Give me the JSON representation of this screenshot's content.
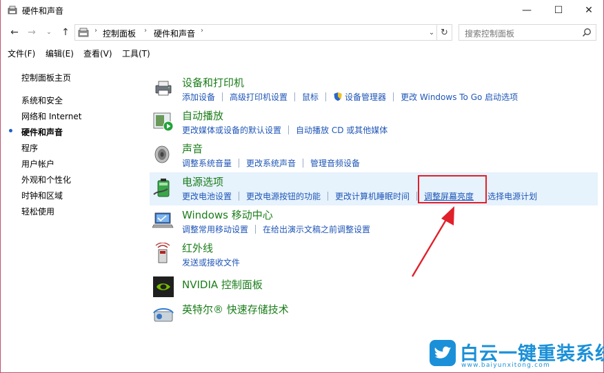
{
  "window": {
    "title": "硬件和声音",
    "controls": {
      "minimize": "—",
      "maximize": "☐",
      "close": "✕"
    }
  },
  "address": {
    "crumbs": [
      "控制面板",
      "硬件和声音"
    ],
    "search_placeholder": "搜索控制面板"
  },
  "menu": [
    "文件(F)",
    "编辑(E)",
    "查看(V)",
    "工具(T)"
  ],
  "nav": {
    "home": "控制面板主页",
    "items": [
      "系统和安全",
      "网络和 Internet",
      "硬件和声音",
      "程序",
      "用户帐户",
      "外观和个性化",
      "时钟和区域",
      "轻松使用"
    ],
    "active_index": 2
  },
  "categories": [
    {
      "title": "设备和打印机",
      "links": [
        "添加设备",
        "高级打印机设置",
        "鼠标",
        "设备管理器",
        "更改 Windows To Go 启动选项"
      ]
    },
    {
      "title": "自动播放",
      "links": [
        "更改媒体或设备的默认设置",
        "自动播放 CD 或其他媒体"
      ]
    },
    {
      "title": "声音",
      "links": [
        "调整系统音量",
        "更改系统声音",
        "管理音频设备"
      ]
    },
    {
      "title": "电源选项",
      "links": [
        "更改电池设置",
        "更改电源按钮的功能",
        "更改计算机睡眠时间",
        "调整屏幕亮度",
        "选择电源计划"
      ]
    },
    {
      "title": "Windows 移动中心",
      "links": [
        "调整常用移动设置",
        "在给出演示文稿之前调整设置"
      ]
    },
    {
      "title": "红外线",
      "links": [
        "发送或接收文件"
      ]
    },
    {
      "title": "NVIDIA 控制面板",
      "links": []
    },
    {
      "title": "英特尔® 快速存储技术",
      "links": []
    }
  ],
  "watermark": {
    "title": "白云一键重装系统",
    "url": "www.baiyunxitong.com"
  },
  "colors": {
    "link": "#1f56b7",
    "category_title": "#1a7d1a",
    "highlight": "#e6f2fc",
    "annotation": "#e0202a"
  }
}
